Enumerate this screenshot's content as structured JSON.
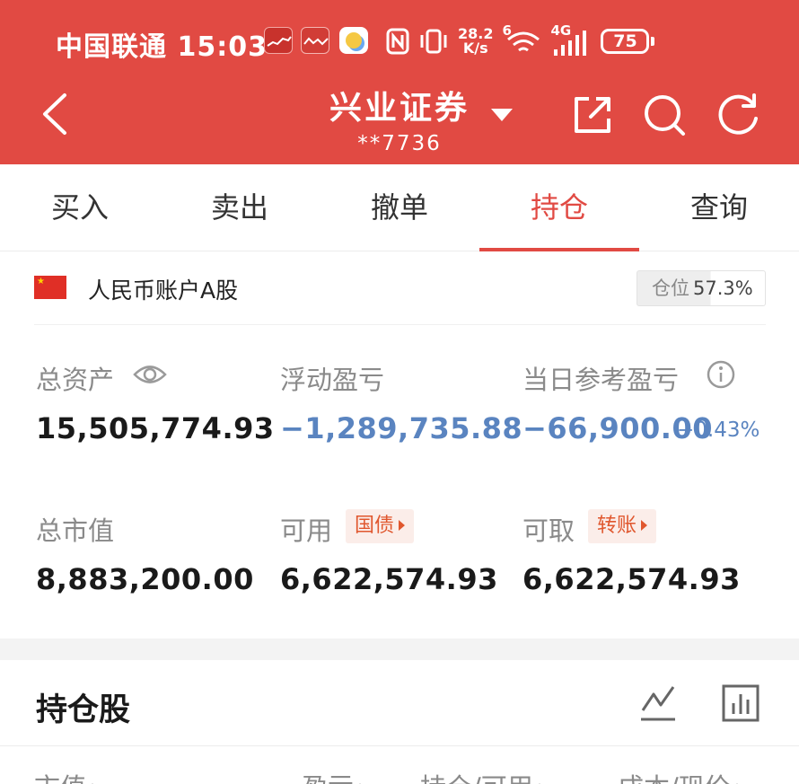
{
  "status_bar": {
    "carrier_time": "中国联通 15:03",
    "net_speed_value": "28.2",
    "net_speed_unit": "K/s",
    "wifi_badge": "6",
    "cell_badge": "4G",
    "battery": "75"
  },
  "nav": {
    "title": "兴业证券",
    "account_no": "**7736"
  },
  "tabs": [
    {
      "label": "买入"
    },
    {
      "label": "卖出"
    },
    {
      "label": "撤单"
    },
    {
      "label": "持仓"
    },
    {
      "label": "查询"
    }
  ],
  "active_tab": "持仓",
  "account": {
    "currency_label": "人民币账户A股",
    "position_label": "仓位",
    "position_value": "57.3%",
    "position_fraction": 0.573
  },
  "stats": {
    "total_assets_label": "总资产",
    "total_assets_value": "15,505,774.93",
    "floating_pl_label": "浮动盈亏",
    "floating_pl_value": "−1,289,735.88",
    "daily_pl_label": "当日参考盈亏",
    "daily_pl_value": "−66,900.00",
    "daily_pl_pct": "−0.43%",
    "market_value_label": "总市值",
    "market_value_value": "8,883,200.00",
    "available_label": "可用",
    "available_tag": "国债",
    "available_value": "6,622,574.93",
    "withdrawable_label": "可取",
    "withdrawable_tag": "转账",
    "withdrawable_value": "6,622,574.93"
  },
  "holdings": {
    "title": "持仓股",
    "columns": [
      {
        "label": "市值"
      },
      {
        "label": "盈亏"
      },
      {
        "label": "持仓/可用"
      },
      {
        "label": "成本/现价"
      }
    ]
  },
  "colors": {
    "brand": "#e14a43",
    "loss": "#5a84c0",
    "tag": "#e0572e"
  }
}
